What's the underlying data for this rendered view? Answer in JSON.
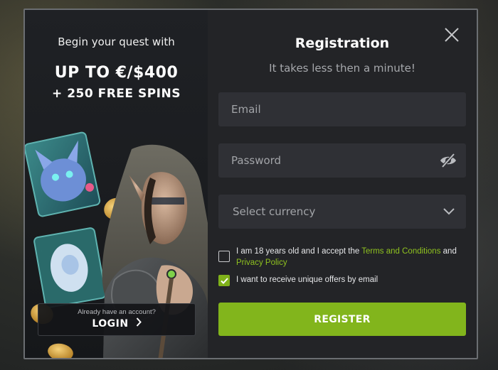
{
  "promo": {
    "tagline": "Begin your quest with",
    "bonus_amount": "UP TO €/$400",
    "bonus_spins": "+ 250 FREE SPINS",
    "login": {
      "hint": "Already have an account?",
      "label": "LOGIN"
    }
  },
  "form": {
    "title": "Registration",
    "subtitle": "It takes less then a minute!",
    "email_placeholder": "Email",
    "password_placeholder": "Password",
    "currency_placeholder": "Select currency",
    "terms": {
      "prefix": "I am 18 years old and I accept the ",
      "terms_link": "Terms and Conditions",
      "middle": " and ",
      "privacy_link": "Privacy Policy",
      "checked": false
    },
    "offers": {
      "label": "I want to receive unique offers by email",
      "checked": true
    },
    "register_label": "REGISTER"
  },
  "icons": {
    "close": "close-icon",
    "password_toggle": "eye-slash-icon",
    "currency_dropdown": "chevron-down-icon",
    "login_arrow": "chevron-right-icon",
    "checkmark": "check-icon"
  },
  "colors": {
    "accent": "#82b51c",
    "link": "#8fc21f",
    "panel": "#232427",
    "field": "#2f3035"
  }
}
